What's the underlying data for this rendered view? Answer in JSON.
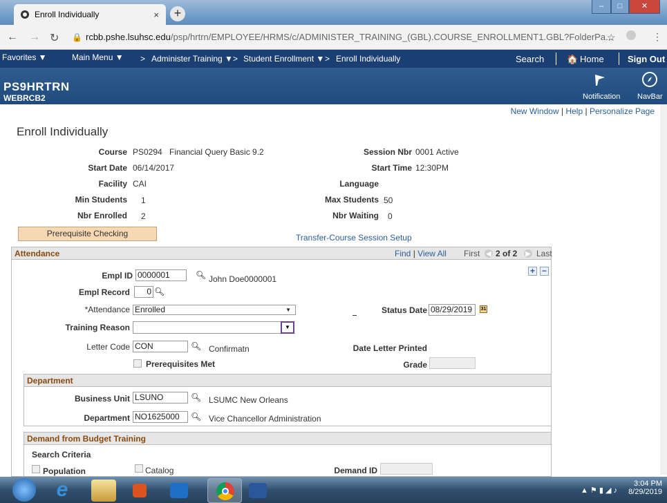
{
  "browser": {
    "tab_title": "Enroll Individually",
    "tab_close": "×",
    "new_tab": "+",
    "url_host": "rcbb.pshe.lsuhsc.edu",
    "url_path": "/psp/hrtrn/EMPLOYEE/HRMS/c/ADMINISTER_TRAINING_(GBL).COURSE_ENROLLMENT1.GBL?FolderPa..."
  },
  "nav": {
    "favorites": "Favorites ▼",
    "main_menu": "Main Menu ▼",
    "crumb1": "Administer Training ▼",
    "crumb2": "Student Enrollment ▼",
    "crumb3": "Enroll Individually",
    "search": "Search",
    "home": "Home",
    "signout": "Sign Out"
  },
  "header": {
    "db": "PS9HRTRN",
    "user": "WEBRCB2",
    "notification": "Notification",
    "navbar": "NavBar"
  },
  "links": {
    "new_window": "New Window",
    "help": "Help",
    "personalize": "Personalize Page"
  },
  "page": {
    "title": "Enroll Individually",
    "course_label": "Course",
    "course_value": "PS0294",
    "course_desc": "Financial Query Basic 9.2",
    "session_label": "Session Nbr",
    "session_value": "0001",
    "session_status": "Active",
    "start_date_label": "Start Date",
    "start_date_value": "06/14/2017",
    "start_time_label": "Start Time",
    "start_time_value": "12:30PM",
    "facility_label": "Facility",
    "facility_value": "CAI",
    "language_label": "Language",
    "min_students_label": "Min Students",
    "min_students_value": "1",
    "max_students_label": "Max Students",
    "max_students_value": "50",
    "nbr_enrolled_label": "Nbr Enrolled",
    "nbr_enrolled_value": "2",
    "nbr_waiting_label": "Nbr Waiting",
    "nbr_waiting_value": "0",
    "prereq_button": "Prerequisite Checking",
    "transfer_link": "Transfer-Course Session Setup"
  },
  "attendance": {
    "header": "Attendance",
    "find": "Find",
    "view_all": "View All",
    "first": "First",
    "count": "2 of 2",
    "last": "Last",
    "emplid_label": "Empl ID",
    "emplid_value": "0000001",
    "empl_name": "John Doe0000001",
    "empl_record_label": "Empl Record",
    "empl_record_value": "0",
    "attendance_label": "*Attendance",
    "attendance_value": "Enrolled",
    "status_date_label": "Status Date",
    "status_date_value": "08/29/2019",
    "training_reason_label": "Training Reason",
    "training_reason_value": "",
    "letter_code_label": "Letter Code",
    "letter_code_value": "CON",
    "letter_code_desc": "Confirmatn",
    "date_letter_label": "Date Letter Printed",
    "prereq_met_label": "Prerequisites Met",
    "grade_label": "Grade",
    "grade_value": ""
  },
  "department": {
    "header": "Department",
    "bu_label": "Business Unit",
    "bu_value": "LSUNO",
    "bu_desc": "LSUMC New Orleans",
    "dept_label": "Department",
    "dept_value": "NO1625000",
    "dept_desc": "Vice Chancellor Administration"
  },
  "demand": {
    "header": "Demand from Budget Training",
    "search_criteria": "Search Criteria",
    "population_label": "Population",
    "catalog_label": "Catalog",
    "demand_id_label": "Demand ID",
    "demand_id_value": ""
  },
  "taskbar": {
    "time": "3:04 PM",
    "date": "8/29/2019"
  }
}
